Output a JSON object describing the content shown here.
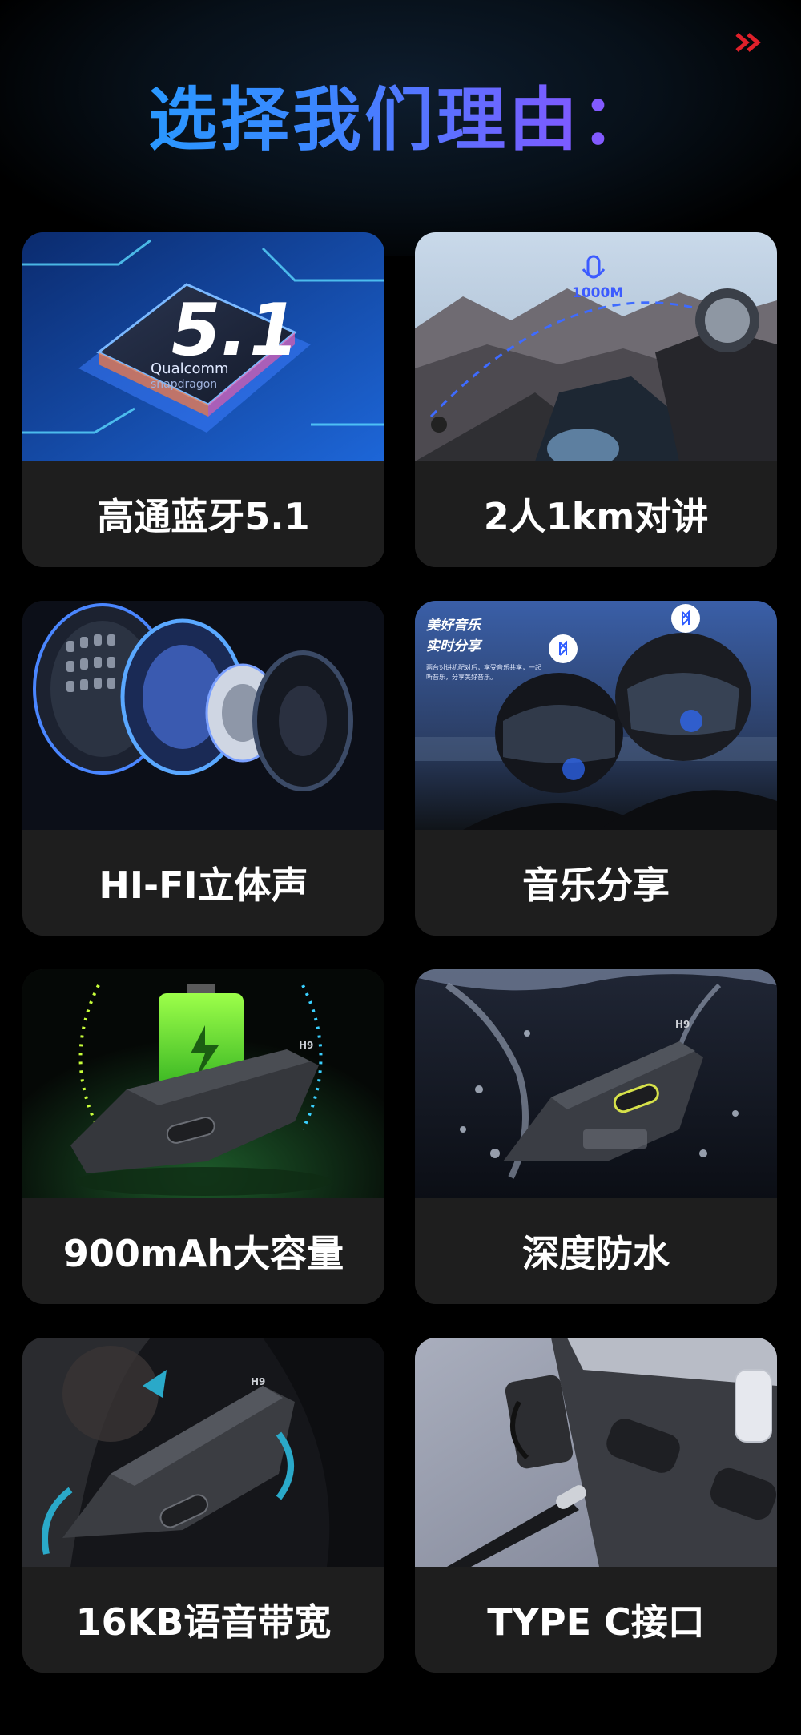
{
  "header": {
    "title": "选择我们理由："
  },
  "features": [
    {
      "caption": "高通蓝牙5.1",
      "badge_text": "5.1",
      "badge_brand": "Qualcomm",
      "badge_sub": "snapdragon"
    },
    {
      "caption": "2人1km对讲",
      "range_text": "1000M"
    },
    {
      "caption": "HI-FI立体声"
    },
    {
      "caption": "音乐分享",
      "overlay_title": "美好音乐",
      "overlay_subtitle": "实时分享",
      "overlay_body": "两台对讲机配对后，享受音乐共享，一起听音乐，分享美好音乐。"
    },
    {
      "caption": "900mAh大容量",
      "device_label": "H9"
    },
    {
      "caption": "深度防水",
      "device_label": "H9"
    },
    {
      "caption": "16KB语音带宽",
      "device_label": "H9"
    },
    {
      "caption": "TYPE C接口"
    }
  ],
  "colors": {
    "background": "#000000",
    "card": "#1e1e1e",
    "title_gradient_start": "#1aa7ff",
    "title_gradient_end": "#b052ff",
    "accent_red": "#e0202a"
  }
}
